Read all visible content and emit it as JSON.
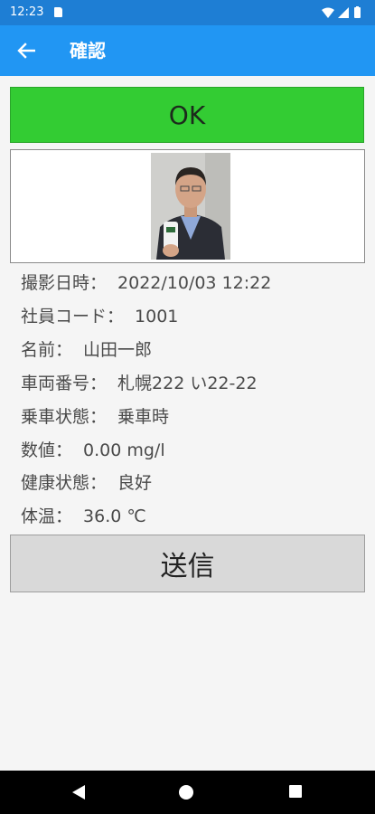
{
  "status_bar": {
    "time": "12:23",
    "icons": [
      "sd-card-icon",
      "wifi-icon",
      "signal-icon",
      "battery-icon"
    ]
  },
  "app_bar": {
    "title": "確認",
    "back_icon": "arrow-back-icon"
  },
  "ok_button": {
    "label": "OK",
    "color": "#33cc33"
  },
  "photo": {
    "icon": "person-photo"
  },
  "details": [
    {
      "label": "撮影日時：",
      "value": "2022/10/03 12:22"
    },
    {
      "label": "社員コード：",
      "value": "1001"
    },
    {
      "label": "名前：",
      "value": "山田一郎"
    },
    {
      "label": "車両番号：",
      "value": "札幌222 い22-22"
    },
    {
      "label": "乗車状態：",
      "value": "乗車時"
    },
    {
      "label": "数値：",
      "value": "0.00 mg/l"
    },
    {
      "label": "健康状態：",
      "value": "良好"
    },
    {
      "label": "体温：",
      "value": "36.0 ℃"
    }
  ],
  "send_button": {
    "label": "送信"
  },
  "nav_bar": {
    "back_icon": "nav-back-icon",
    "home_icon": "nav-home-icon",
    "recents_icon": "nav-recents-icon"
  },
  "colors": {
    "status_bar": "#1e7ed4",
    "app_bar": "#2196f3",
    "ok_button": "#33cc33",
    "send_button": "#d9d9d9"
  }
}
